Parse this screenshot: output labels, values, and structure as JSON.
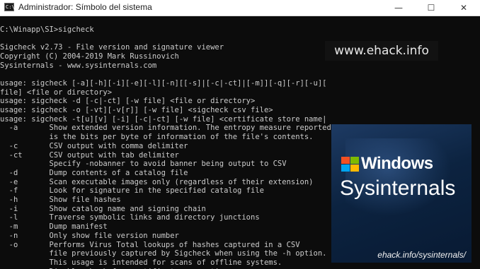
{
  "window": {
    "app_icon_text": "C:\\",
    "title": "Administrador: Símbolo del sistema",
    "minimize_glyph": "—",
    "maximize_glyph": "☐",
    "close_glyph": "✕"
  },
  "console": {
    "lines": [
      "",
      "C:\\Winapp\\SI>sigcheck",
      "",
      "Sigcheck v2.73 - File version and signature viewer",
      "Copyright (C) 2004-2019 Mark Russinovich",
      "Sysinternals - www.sysinternals.com",
      "",
      "usage: sigcheck [-a][-h][-i][-e][-l][-n][[-s]|[-c|-ct]|[-m]][-q][-r][-u][",
      "file] <file or directory>",
      "usage: sigcheck -d [-c|-ct] [-w file] <file or directory>",
      "usage: sigcheck -o [-vt][-v[r]] [-w file] <sigcheck csv file>",
      "usage: sigcheck -t[u][v] [-i] [-c|-ct] [-w file] <certificate store name|",
      "  -a       Show extended version information. The entropy measure reported",
      "           is the bits per byte of information of the file's contents.",
      "  -c       CSV output with comma delimiter",
      "  -ct      CSV output with tab delimiter",
      "           Specify -nobanner to avoid banner being output to CSV",
      "  -d       Dump contents of a catalog file",
      "  -e       Scan executable images only (regardless of their extension)",
      "  -f       Look for signature in the specified catalog file",
      "  -h       Show file hashes",
      "  -i       Show catalog name and signing chain",
      "  -l       Traverse symbolic links and directory junctions",
      "  -m       Dump manifest",
      "  -n       Only show file version number",
      "  -o       Performs Virus Total lookups of hashes captured in a CSV",
      "           file previously captured by Sigcheck when using the -h option.",
      "           This usage is intended for scans of offline systems.",
      "  -r       Disable check for certificate revocation"
    ]
  },
  "watermark": "www.ehack.info",
  "banner": {
    "word1": "Windows",
    "word2": "Sysinternals",
    "link": "ehack.info/sysinternals/"
  }
}
